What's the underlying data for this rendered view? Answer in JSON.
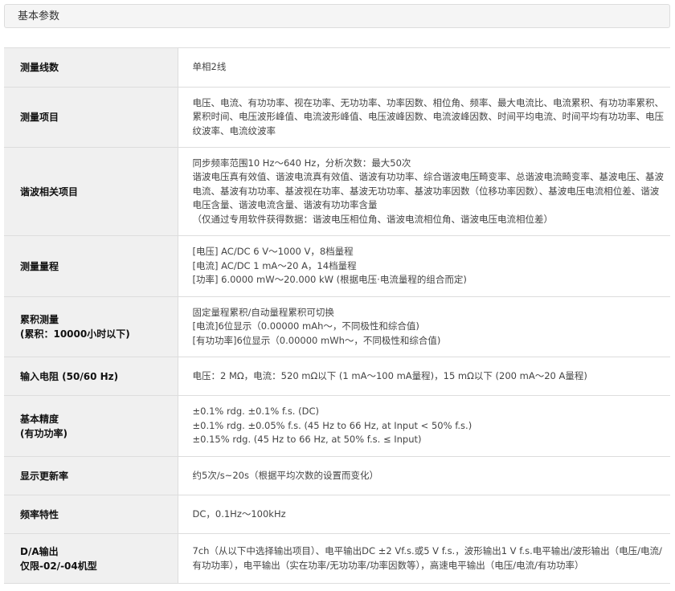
{
  "section": {
    "title": "基本参数"
  },
  "rows": [
    {
      "label": [
        "测量线数"
      ],
      "value": [
        "单相2线"
      ]
    },
    {
      "label": [
        "测量项目"
      ],
      "value": [
        "电压、电流、有功功率、视在功率、无功功率、功率因数、相位角、频率、最大电流比、电流累积、有功功率累积、累积时间、电压波形峰值、电流波形峰值、电压波峰因数、电流波峰因数、时间平均电流、时间平均有功功率、电压纹波率、电流纹波率"
      ]
    },
    {
      "label": [
        "谐波相关项目"
      ],
      "value": [
        "同步频率范围10 Hz～640 Hz，分析次数：最大50次",
        "谐波电压真有效值、谐波电流真有效值、谐波有功功率、综合谐波电压畸变率、总谐波电流畸变率、基波电压、基波电流、基波有功功率、基波视在功率、基波无功功率、基波功率因数（位移功率因数）、基波电压电流相位差、谐波电压含量、谐波电流含量、谐波有功功率含量",
        "（仅通过专用软件获得数据：谐波电压相位角、谐波电流相位角、谐波电压电流相位差）"
      ]
    },
    {
      "label": [
        "测量量程"
      ],
      "value": [
        "[电压] AC/DC 6 V～1000 V，8档量程",
        "[电流] AC/DC 1 mA～20 A，14档量程",
        "[功率] 6.0000 mW～20.000 kW (根据电压·电流量程的组合而定)"
      ]
    },
    {
      "label": [
        "累积测量",
        "(累积：10000小时以下)"
      ],
      "value": [
        "固定量程累积/自动量程累积可切换",
        "[电流]6位显示（0.00000 mAh～，不同极性和综合值)",
        "[有功功率]6位显示（0.00000 mWh～，不同极性和综合值)"
      ]
    },
    {
      "label": [
        "输入电阻 (50/60 Hz)"
      ],
      "value": [
        "电压：2 MΩ，电流：520 mΩ以下 (1 mA～100 mA量程)，15 mΩ以下 (200 mA～20 A量程)"
      ]
    },
    {
      "label": [
        "基本精度",
        "(有功功率)"
      ],
      "value": [
        "±0.1% rdg. ±0.1% f.s. (DC)",
        "±0.1% rdg. ±0.05% f.s. (45 Hz to 66 Hz, at Input < 50% f.s.)",
        "±0.15% rdg. (45 Hz to 66 Hz, at 50% f.s. ≤ Input)"
      ]
    },
    {
      "label": [
        "显示更新率"
      ],
      "value": [
        "约5次/s~20s（根据平均次数的设置而变化）"
      ]
    },
    {
      "label": [
        "频率特性"
      ],
      "value": [
        "DC，0.1Hz～100kHz"
      ]
    },
    {
      "label": [
        "D/A输出",
        "仅限-02/-04机型"
      ],
      "value": [
        "7ch（从以下中选择输出项目）、电平输出DC ±2 Vf.s.或5 V f.s.，波形输出1 V f.s.电平输出/波形输出（电压/电流/有功功率），电平输出（实在功率/无功功率/功率因数等），高速电平输出（电压/电流/有功功率）"
      ]
    }
  ]
}
